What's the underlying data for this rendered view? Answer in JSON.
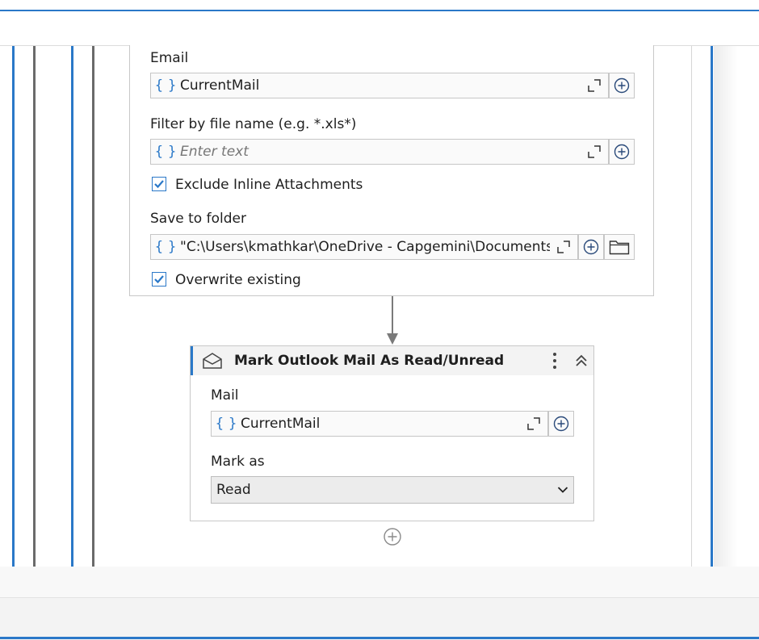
{
  "card1": {
    "email_label": "Email",
    "email_value": "CurrentMail",
    "filter_label": "Filter by file name (e.g. *.xls*)",
    "filter_placeholder": "Enter text",
    "exclude_inline_label": "Exclude Inline Attachments",
    "exclude_inline_checked": true,
    "save_folder_label": "Save to folder",
    "save_folder_value": "\"C:\\Users\\kmathkar\\OneDrive - Capgemini\\Documents\\U",
    "overwrite_label": "Overwrite existing",
    "overwrite_checked": true
  },
  "card2": {
    "title": "Mark Outlook Mail As Read/Unread",
    "mail_label": "Mail",
    "mail_value": "CurrentMail",
    "mark_as_label": "Mark as",
    "mark_as_value": "Read"
  },
  "icons": {
    "variable": "{ }"
  },
  "colors": {
    "accent": "#2a78c8"
  }
}
